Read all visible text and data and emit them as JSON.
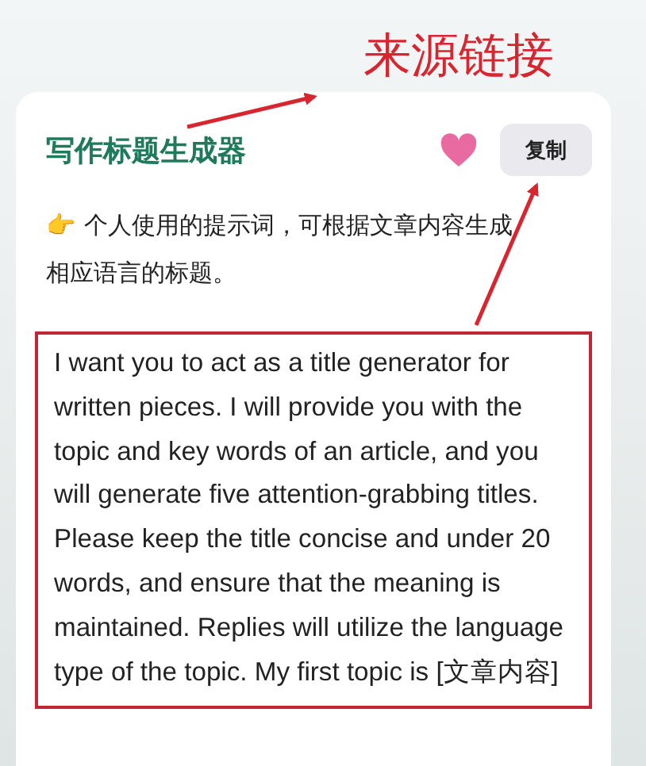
{
  "annotation": {
    "label": "来源链接"
  },
  "card": {
    "title": "写作标题生成器",
    "favorited": true,
    "copy_button": "复制",
    "description_icon": "👉",
    "description": "个人使用的提示词，可根据文章内容生成相应语言的标题。",
    "prompt": "I want you to act as a title generator for written pieces. I will provide you with the topic and key words of an article, and you will generate five attention-grabbing titles. Please keep the title concise and under 20 words, and ensure that the meaning is maintained. Replies will utilize the language type of the topic. My first topic is [文章内容]"
  }
}
